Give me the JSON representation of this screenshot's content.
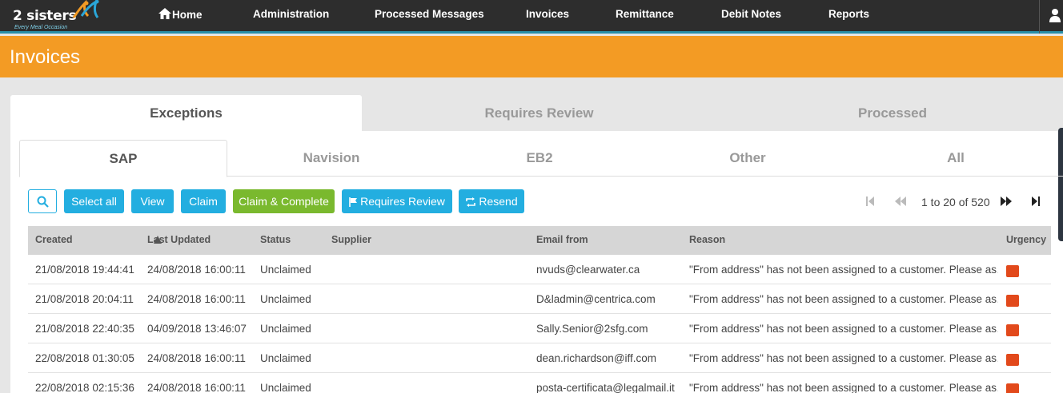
{
  "brand": {
    "name": "2 sisters",
    "tagline": "Every Meal Occasion"
  },
  "nav": {
    "items": [
      {
        "label": "Home",
        "icon": "home-icon"
      },
      {
        "label": "Administration"
      },
      {
        "label": "Processed Messages"
      },
      {
        "label": "Invoices"
      },
      {
        "label": "Remittance"
      },
      {
        "label": "Debit Notes"
      },
      {
        "label": "Reports"
      }
    ],
    "user_icon": "user-icon"
  },
  "page": {
    "title": "Invoices"
  },
  "main_tabs": [
    {
      "label": "Exceptions",
      "active": true
    },
    {
      "label": "Requires Review",
      "active": false
    },
    {
      "label": "Processed",
      "active": false
    }
  ],
  "sub_tabs": [
    {
      "label": "SAP",
      "active": true
    },
    {
      "label": "Navision",
      "active": false
    },
    {
      "label": "EB2",
      "active": false
    },
    {
      "label": "Other",
      "active": false
    },
    {
      "label": "All",
      "active": false
    }
  ],
  "toolbar": {
    "search_icon": "search-icon",
    "select_all": "Select all",
    "view": "View",
    "claim": "Claim",
    "claim_complete": "Claim & Complete",
    "requires_review": "Requires Review",
    "resend": "Resend"
  },
  "pager": {
    "text": "1 to 20 of 520"
  },
  "table": {
    "columns": [
      "Created",
      "Last Updated",
      "Status",
      "Supplier",
      "Email from",
      "Reason",
      "Urgency"
    ],
    "sort_column": "Created",
    "rows": [
      {
        "created": "21/08/2018 19:44:41",
        "updated": "24/08/2018 16:00:11",
        "status": "Unclaimed",
        "supplier": "",
        "email": "nvuds@clearwater.ca",
        "reason": "\"From address\" has not been assigned to a customer. Please as…",
        "urgency": "high"
      },
      {
        "created": "21/08/2018 20:04:11",
        "updated": "24/08/2018 16:00:11",
        "status": "Unclaimed",
        "supplier": "",
        "email": "D&ladmin@centrica.com",
        "reason": "\"From address\" has not been assigned to a customer. Please as…",
        "urgency": "high"
      },
      {
        "created": "21/08/2018 22:40:35",
        "updated": "04/09/2018 13:46:07",
        "status": "Unclaimed",
        "supplier": "",
        "email": "Sally.Senior@2sfg.com",
        "reason": "\"From address\" has not been assigned to a customer. Please as…",
        "urgency": "high"
      },
      {
        "created": "22/08/2018 01:30:05",
        "updated": "24/08/2018 16:00:11",
        "status": "Unclaimed",
        "supplier": "",
        "email": "dean.richardson@iff.com",
        "reason": "\"From address\" has not been assigned to a customer. Please as…",
        "urgency": "high"
      },
      {
        "created": "22/08/2018 02:15:36",
        "updated": "24/08/2018 16:00:11",
        "status": "Unclaimed",
        "supplier": "",
        "email": "posta-certificata@legalmail.it",
        "reason": "\"From address\" has not been assigned to a customer. Please as…",
        "urgency": "high"
      }
    ]
  },
  "colors": {
    "nav_bg": "#2d2d2d",
    "header_orange": "#f39b24",
    "button_blue": "#23aee0",
    "button_green": "#7ab92e",
    "urgency_high": "#e2491b"
  }
}
